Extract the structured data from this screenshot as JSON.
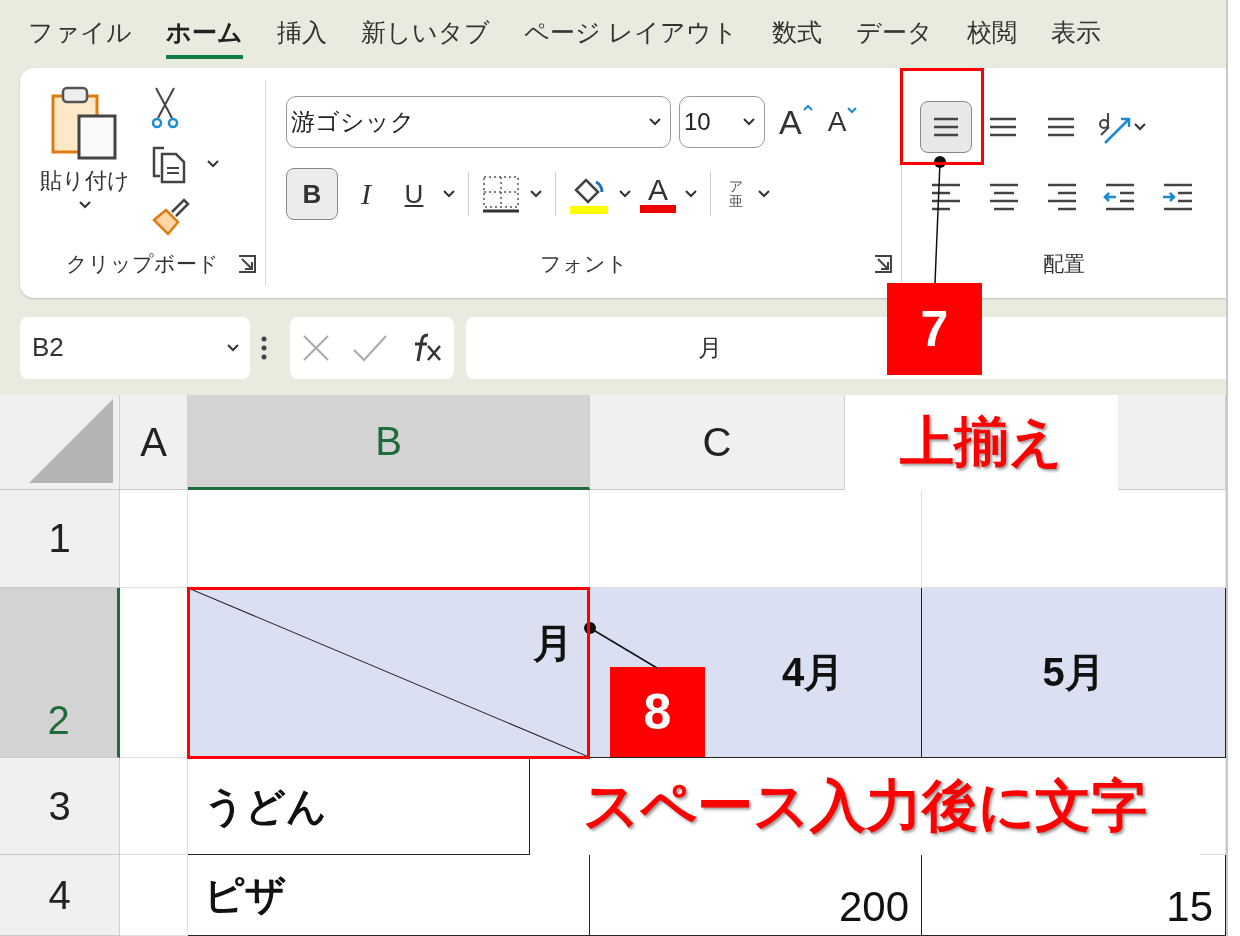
{
  "tabs": [
    {
      "label": "ファイル",
      "selected": false
    },
    {
      "label": "ホーム",
      "selected": true
    },
    {
      "label": "挿入",
      "selected": false
    },
    {
      "label": "新しいタブ",
      "selected": false
    },
    {
      "label": "ページ レイアウト",
      "selected": false
    },
    {
      "label": "数式",
      "selected": false
    },
    {
      "label": "データ",
      "selected": false
    },
    {
      "label": "校閲",
      "selected": false
    },
    {
      "label": "表示",
      "selected": false
    }
  ],
  "ribbon": {
    "clipboard": {
      "paste_label": "貼り付け",
      "group_label": "クリップボード"
    },
    "font": {
      "font_name": "游ゴシック",
      "font_size": "10",
      "grow_label": "A",
      "shrink_label": "A",
      "bold_label": "B",
      "bold": true,
      "italic_label": "I",
      "underline_label": "U",
      "font_color_label": "A",
      "phonetic_top": "ア",
      "phonetic_bottom": "亜",
      "group_label": "フォント"
    },
    "alignment": {
      "buttons": [
        {
          "kind": "top",
          "selected": true
        },
        {
          "kind": "middle",
          "selected": false
        },
        {
          "kind": "bottom",
          "selected": false
        },
        {
          "kind": "orientation",
          "selected": false
        },
        {
          "kind": "left",
          "selected": false
        },
        {
          "kind": "center",
          "selected": false
        },
        {
          "kind": "right",
          "selected": false
        },
        {
          "kind": "indent-decrease",
          "selected": false
        },
        {
          "kind": "indent-increase",
          "selected": false
        }
      ],
      "group_label": "配置"
    }
  },
  "formula_bar": {
    "name_box": "B2",
    "formula": "月"
  },
  "sheet": {
    "columns": [
      {
        "label": "A",
        "selected": false
      },
      {
        "label": "B",
        "selected": true
      },
      {
        "label": "C",
        "selected": false
      }
    ],
    "rows": [
      {
        "label": "1",
        "selected": false,
        "cells": []
      },
      {
        "label": "2",
        "selected": true,
        "cells": [
          {
            "kind": "diagonal",
            "text": "月"
          },
          {
            "kind": "header",
            "text": "4月"
          },
          {
            "kind": "header",
            "text": "5月"
          }
        ]
      },
      {
        "label": "3",
        "selected": false,
        "cells": [
          {
            "kind": "item",
            "text": "うどん"
          }
        ]
      },
      {
        "label": "4",
        "selected": false,
        "cells": [
          {
            "kind": "item",
            "text": "ピザ"
          },
          {
            "kind": "number",
            "text": "200"
          },
          {
            "kind": "number",
            "text": "15"
          }
        ]
      }
    ]
  },
  "annotations": [
    {
      "number": "7",
      "caption": "上揃え"
    },
    {
      "number": "8",
      "caption": "スペース入力後に文字"
    }
  ]
}
